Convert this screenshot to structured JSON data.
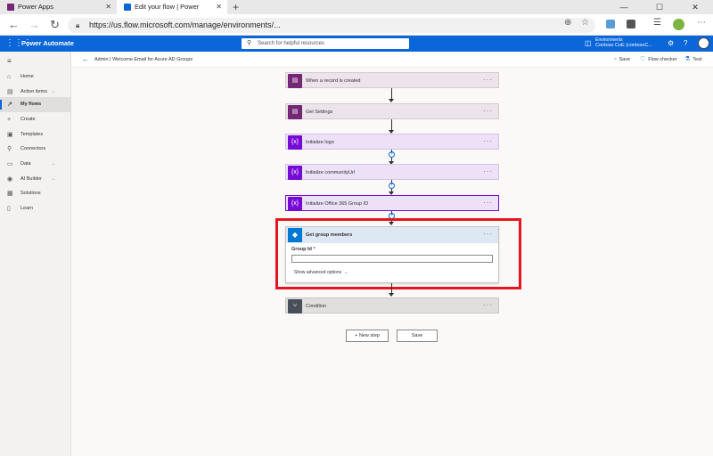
{
  "browser": {
    "tabs": [
      {
        "label": "Power Apps",
        "favicon_color": "#742774"
      },
      {
        "label": "Edit your flow | Power Automate",
        "favicon_color": "#0a66d9"
      }
    ],
    "url": "https://us.flow.microsoft.com/manage/environments/..."
  },
  "header": {
    "app_title": "Power Automate",
    "search_placeholder": "Search for helpful resources",
    "env_label": "Environments",
    "env_value": "Contoso CoE (contosoC...",
    "brand_color": "#0a66d9"
  },
  "sidebar": {
    "items": [
      {
        "label": "Home",
        "icon": "home-icon",
        "glyph": "⌂"
      },
      {
        "label": "Action items",
        "icon": "clipboard-icon",
        "glyph": "▤",
        "chevron": true
      },
      {
        "label": "My flows",
        "icon": "flow-icon",
        "glyph": "↗",
        "active": true
      },
      {
        "label": "Create",
        "icon": "plus-icon",
        "glyph": "+"
      },
      {
        "label": "Templates",
        "icon": "templates-icon",
        "glyph": "▣"
      },
      {
        "label": "Connectors",
        "icon": "connector-icon",
        "glyph": "⚲"
      },
      {
        "label": "Data",
        "icon": "database-icon",
        "glyph": "▭",
        "chevron": true
      },
      {
        "label": "AI Builder",
        "icon": "ai-icon",
        "glyph": "◉",
        "chevron": true
      },
      {
        "label": "Solutions",
        "icon": "solutions-icon",
        "glyph": "▦"
      },
      {
        "label": "Learn",
        "icon": "book-icon",
        "glyph": "▯"
      }
    ]
  },
  "command_bar": {
    "flow_title": "Admin | Welcome Email for Azure AD Groups",
    "save": "Save",
    "flow_checker": "Flow checker",
    "test": "Test"
  },
  "steps": [
    {
      "title": "When a record is created",
      "icon": "dataverse-icon",
      "color": "#742774"
    },
    {
      "title": "Get Settings",
      "icon": "dataverse-icon",
      "color": "#742774"
    },
    {
      "title": "Initialize logo",
      "icon": "variable-icon",
      "color": "#770bd6"
    },
    {
      "title": "Initialize communityUrl",
      "icon": "variable-icon",
      "color": "#770bd6"
    },
    {
      "title": "Initialize Office 365 Group ID",
      "icon": "variable-icon",
      "color": "#770bd6"
    }
  ],
  "expanded_action": {
    "title": "Get group members",
    "field_label": "Group Id",
    "field_required": "*",
    "field_value": "",
    "advanced": "Show advanced options"
  },
  "condition": {
    "title": "Condition"
  },
  "buttons": {
    "new_step": "+ New step",
    "save": "Save"
  }
}
